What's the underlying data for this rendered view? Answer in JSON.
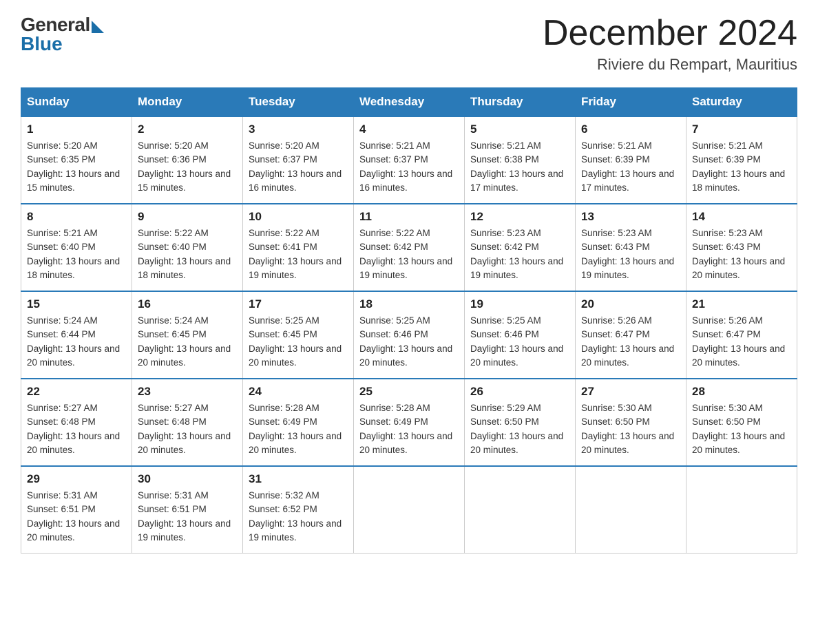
{
  "logo": {
    "general": "General",
    "blue": "Blue"
  },
  "title": "December 2024",
  "subtitle": "Riviere du Rempart, Mauritius",
  "weekdays": [
    "Sunday",
    "Monday",
    "Tuesday",
    "Wednesday",
    "Thursday",
    "Friday",
    "Saturday"
  ],
  "weeks": [
    [
      {
        "day": 1,
        "sunrise": "5:20 AM",
        "sunset": "6:35 PM",
        "daylight": "13 hours and 15 minutes."
      },
      {
        "day": 2,
        "sunrise": "5:20 AM",
        "sunset": "6:36 PM",
        "daylight": "13 hours and 15 minutes."
      },
      {
        "day": 3,
        "sunrise": "5:20 AM",
        "sunset": "6:37 PM",
        "daylight": "13 hours and 16 minutes."
      },
      {
        "day": 4,
        "sunrise": "5:21 AM",
        "sunset": "6:37 PM",
        "daylight": "13 hours and 16 minutes."
      },
      {
        "day": 5,
        "sunrise": "5:21 AM",
        "sunset": "6:38 PM",
        "daylight": "13 hours and 17 minutes."
      },
      {
        "day": 6,
        "sunrise": "5:21 AM",
        "sunset": "6:39 PM",
        "daylight": "13 hours and 17 minutes."
      },
      {
        "day": 7,
        "sunrise": "5:21 AM",
        "sunset": "6:39 PM",
        "daylight": "13 hours and 18 minutes."
      }
    ],
    [
      {
        "day": 8,
        "sunrise": "5:21 AM",
        "sunset": "6:40 PM",
        "daylight": "13 hours and 18 minutes."
      },
      {
        "day": 9,
        "sunrise": "5:22 AM",
        "sunset": "6:40 PM",
        "daylight": "13 hours and 18 minutes."
      },
      {
        "day": 10,
        "sunrise": "5:22 AM",
        "sunset": "6:41 PM",
        "daylight": "13 hours and 19 minutes."
      },
      {
        "day": 11,
        "sunrise": "5:22 AM",
        "sunset": "6:42 PM",
        "daylight": "13 hours and 19 minutes."
      },
      {
        "day": 12,
        "sunrise": "5:23 AM",
        "sunset": "6:42 PM",
        "daylight": "13 hours and 19 minutes."
      },
      {
        "day": 13,
        "sunrise": "5:23 AM",
        "sunset": "6:43 PM",
        "daylight": "13 hours and 19 minutes."
      },
      {
        "day": 14,
        "sunrise": "5:23 AM",
        "sunset": "6:43 PM",
        "daylight": "13 hours and 20 minutes."
      }
    ],
    [
      {
        "day": 15,
        "sunrise": "5:24 AM",
        "sunset": "6:44 PM",
        "daylight": "13 hours and 20 minutes."
      },
      {
        "day": 16,
        "sunrise": "5:24 AM",
        "sunset": "6:45 PM",
        "daylight": "13 hours and 20 minutes."
      },
      {
        "day": 17,
        "sunrise": "5:25 AM",
        "sunset": "6:45 PM",
        "daylight": "13 hours and 20 minutes."
      },
      {
        "day": 18,
        "sunrise": "5:25 AM",
        "sunset": "6:46 PM",
        "daylight": "13 hours and 20 minutes."
      },
      {
        "day": 19,
        "sunrise": "5:25 AM",
        "sunset": "6:46 PM",
        "daylight": "13 hours and 20 minutes."
      },
      {
        "day": 20,
        "sunrise": "5:26 AM",
        "sunset": "6:47 PM",
        "daylight": "13 hours and 20 minutes."
      },
      {
        "day": 21,
        "sunrise": "5:26 AM",
        "sunset": "6:47 PM",
        "daylight": "13 hours and 20 minutes."
      }
    ],
    [
      {
        "day": 22,
        "sunrise": "5:27 AM",
        "sunset": "6:48 PM",
        "daylight": "13 hours and 20 minutes."
      },
      {
        "day": 23,
        "sunrise": "5:27 AM",
        "sunset": "6:48 PM",
        "daylight": "13 hours and 20 minutes."
      },
      {
        "day": 24,
        "sunrise": "5:28 AM",
        "sunset": "6:49 PM",
        "daylight": "13 hours and 20 minutes."
      },
      {
        "day": 25,
        "sunrise": "5:28 AM",
        "sunset": "6:49 PM",
        "daylight": "13 hours and 20 minutes."
      },
      {
        "day": 26,
        "sunrise": "5:29 AM",
        "sunset": "6:50 PM",
        "daylight": "13 hours and 20 minutes."
      },
      {
        "day": 27,
        "sunrise": "5:30 AM",
        "sunset": "6:50 PM",
        "daylight": "13 hours and 20 minutes."
      },
      {
        "day": 28,
        "sunrise": "5:30 AM",
        "sunset": "6:50 PM",
        "daylight": "13 hours and 20 minutes."
      }
    ],
    [
      {
        "day": 29,
        "sunrise": "5:31 AM",
        "sunset": "6:51 PM",
        "daylight": "13 hours and 20 minutes."
      },
      {
        "day": 30,
        "sunrise": "5:31 AM",
        "sunset": "6:51 PM",
        "daylight": "13 hours and 19 minutes."
      },
      {
        "day": 31,
        "sunrise": "5:32 AM",
        "sunset": "6:52 PM",
        "daylight": "13 hours and 19 minutes."
      },
      null,
      null,
      null,
      null
    ]
  ]
}
